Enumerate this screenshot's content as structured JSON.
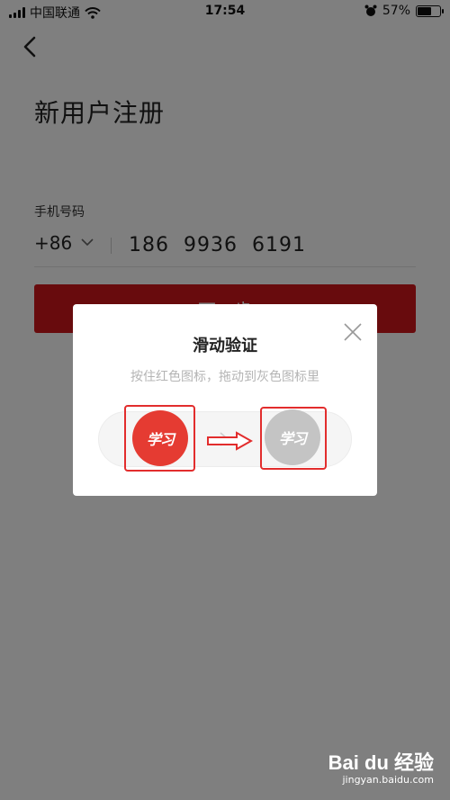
{
  "status_bar": {
    "carrier": "中国联通",
    "time": "17:54",
    "battery_percent": "57%",
    "battery_level": 0.57,
    "icons": [
      "signal-icon",
      "wifi-icon",
      "alarm-icon",
      "battery-icon"
    ]
  },
  "page": {
    "title": "新用户注册",
    "phone_label": "手机号码",
    "country_code": "+86",
    "phone_value": "186  9936  6191",
    "next_button": "下一步"
  },
  "dialog": {
    "title": "滑动验证",
    "subtitle": "按住红色图标，拖动到灰色图标里",
    "knob_label": "学习",
    "target_label": "学习"
  },
  "watermark": {
    "logo": "Bai du 经验",
    "url": "jingyan.baidu.com"
  },
  "colors": {
    "brand_red": "#d1161b",
    "knob_red": "#e53b32",
    "target_gray": "#c4c4c4",
    "annotation_red": "#e22d2d"
  }
}
